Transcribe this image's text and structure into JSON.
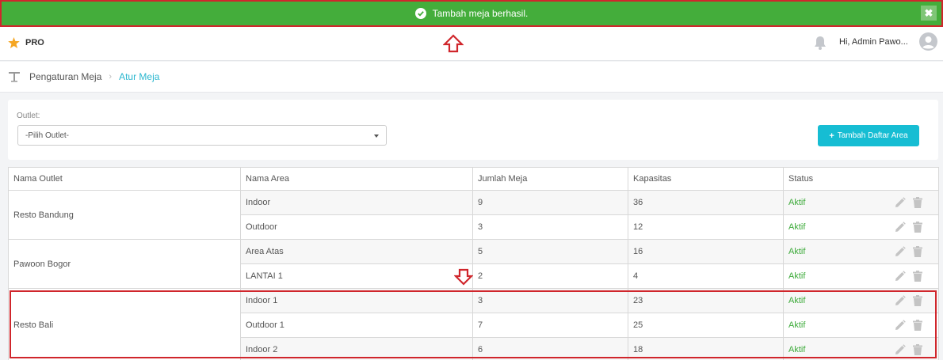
{
  "toast": {
    "message": "Tambah meja berhasil.",
    "close_label": "✖"
  },
  "header": {
    "brand": "PRO",
    "greeting": "Hi, Admin Pawo..."
  },
  "breadcrumb": {
    "parent": "Pengaturan Meja",
    "separator": "›",
    "current": "Atur Meja"
  },
  "filter": {
    "outlet_label": "Outlet:",
    "outlet_selected": "-Pilih Outlet-",
    "add_area_button": "Tambah Daftar Area"
  },
  "table": {
    "headers": [
      "Nama Outlet",
      "Nama Area",
      "Jumlah Meja",
      "Kapasitas",
      "Status"
    ],
    "outlets": [
      {
        "name": "Resto Bandung",
        "areas": [
          {
            "area": "Indoor",
            "tables": "9",
            "capacity": "36",
            "status": "Aktif"
          },
          {
            "area": "Outdoor",
            "tables": "3",
            "capacity": "12",
            "status": "Aktif"
          }
        ]
      },
      {
        "name": "Pawoon Bogor",
        "areas": [
          {
            "area": "Area Atas",
            "tables": "5",
            "capacity": "16",
            "status": "Aktif"
          },
          {
            "area": "LANTAI 1",
            "tables": "2",
            "capacity": "4",
            "status": "Aktif"
          }
        ]
      },
      {
        "name": "Resto Bali",
        "areas": [
          {
            "area": "Indoor 1",
            "tables": "3",
            "capacity": "23",
            "status": "Aktif"
          },
          {
            "area": "Outdoor 1",
            "tables": "7",
            "capacity": "25",
            "status": "Aktif"
          },
          {
            "area": "Indoor 2",
            "tables": "6",
            "capacity": "18",
            "status": "Aktif"
          }
        ]
      }
    ]
  },
  "colors": {
    "toast_bg": "#44ad3b",
    "highlight": "#d0262c",
    "accent": "#16bdd3",
    "status_active": "#3daa3a",
    "brand_star": "#f5a623"
  },
  "icons": [
    "check-circle-icon",
    "close-icon",
    "star-icon",
    "bell-icon",
    "user-avatar-icon",
    "table-icon",
    "chevron-right-icon",
    "plus-icon",
    "edit-pencil-icon",
    "trash-icon",
    "up-arrow-icon",
    "down-arrow-icon"
  ]
}
